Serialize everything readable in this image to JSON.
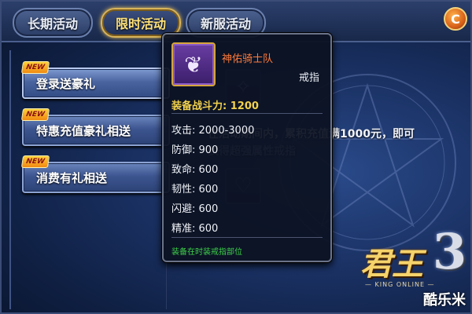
{
  "tabs": [
    {
      "label": "长期活动",
      "active": false
    },
    {
      "label": "限时活动",
      "active": true
    },
    {
      "label": "新服活动",
      "active": false
    }
  ],
  "close_button": {
    "icon": "close-icon",
    "glyph": "C"
  },
  "menu": {
    "badge_label": "NEW",
    "items": [
      {
        "label": "登录送豪礼",
        "selected": true
      },
      {
        "label": "特惠充值豪礼相送",
        "selected": false
      },
      {
        "label": "消费有礼相送",
        "selected": false
      }
    ]
  },
  "activity": {
    "desc_line1": "在活动期间内，累积充值满1000元，即可",
    "desc_line2": "获得超强属性戒指"
  },
  "tooltip": {
    "item_name": "神佑骑士队",
    "item_type": "戒指",
    "power_label": "装备战斗力: 1200",
    "stats": [
      "攻击: 2000-3000",
      "防御: 900",
      "致命: 600",
      "韧性: 600",
      "闪避: 600",
      "精准: 600"
    ],
    "note": "装备在时装戒指部位"
  },
  "logo": {
    "main": "君王",
    "num": "3",
    "sub": "— KING ONLINE —"
  },
  "watermark": "酷乐米",
  "colors": {
    "accent_gold": "#f3d24c",
    "item_name": "#ff7a3a",
    "note_green": "#3ed34a"
  }
}
